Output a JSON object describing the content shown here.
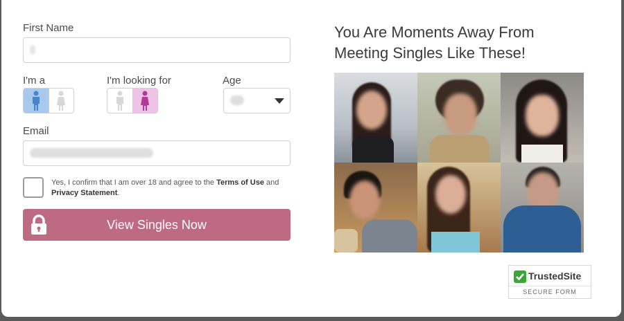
{
  "form": {
    "first_name_label": "First Name",
    "first_name_value": "",
    "im_a_label": "I'm a",
    "looking_for_label": "I'm looking for",
    "age_label": "Age",
    "age_value": "",
    "email_label": "Email",
    "email_value": "",
    "consent_part1": "Yes, I confirm that I am over 18 and agree to the ",
    "consent_terms": "Terms of Use",
    "consent_and": " and ",
    "consent_privacy": "Privacy Statement",
    "consent_end": ".",
    "consent_checked": false,
    "im_a_selected": "male",
    "looking_for_selected": "female",
    "submit_label": "View Singles Now"
  },
  "promo": {
    "headline_line1": "You Are Moments Away From",
    "headline_line2": "Meeting Singles Like These!"
  },
  "photos": [
    {
      "name": "profile-photo"
    },
    {
      "name": "profile-photo"
    },
    {
      "name": "profile-photo"
    },
    {
      "name": "profile-photo"
    },
    {
      "name": "profile-photo"
    },
    {
      "name": "profile-photo"
    }
  ],
  "badge": {
    "brand": "TrustedSite",
    "subtitle": "SECURE FORM"
  },
  "colors": {
    "cta": "#be6a82",
    "male_selected": "#a8c8ee",
    "female_selected": "#efc3e6",
    "trust_green": "#3aa63a"
  },
  "icons": {
    "lock": "lock-icon",
    "male": "male-icon",
    "female": "female-icon",
    "dropdown": "chevron-down-icon",
    "check": "check-icon"
  }
}
